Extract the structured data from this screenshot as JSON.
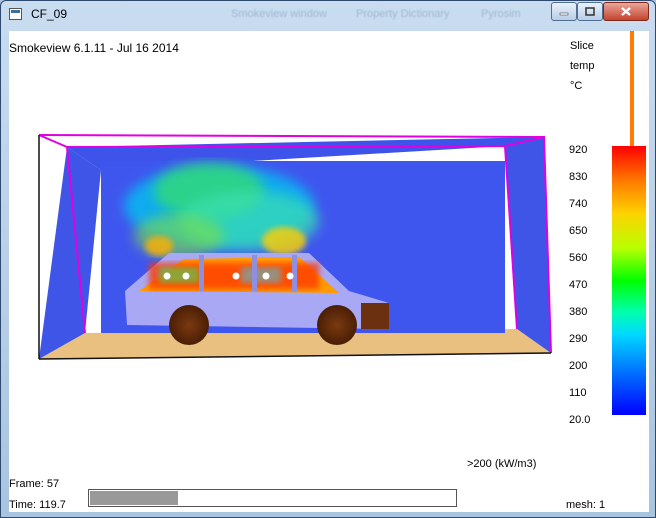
{
  "window": {
    "title": "CF_09",
    "ghost_tabs": [
      "Smokeview window",
      "Property Dictionary",
      "Pyrosim"
    ]
  },
  "header": {
    "version": "Smokeview 6.1.11  -  Jul 16 2014"
  },
  "legend": {
    "title_lines": [
      "Slice",
      "temp",
      "°C"
    ],
    "ticks": [
      "920",
      "830",
      "740",
      "650",
      "560",
      "470",
      "380",
      "290",
      "200",
      "110",
      "20.0"
    ]
  },
  "status": {
    "hrr_label": ">200 (kW/m3)",
    "frame": "Frame: 57",
    "time": "Time: 119.7",
    "mesh": "mesh: 1",
    "progress_fraction": 0.24
  },
  "icons": {
    "window": "app-window-icon",
    "minimize": "minimize-icon",
    "maximize": "maximize-icon",
    "close": "close-icon"
  }
}
